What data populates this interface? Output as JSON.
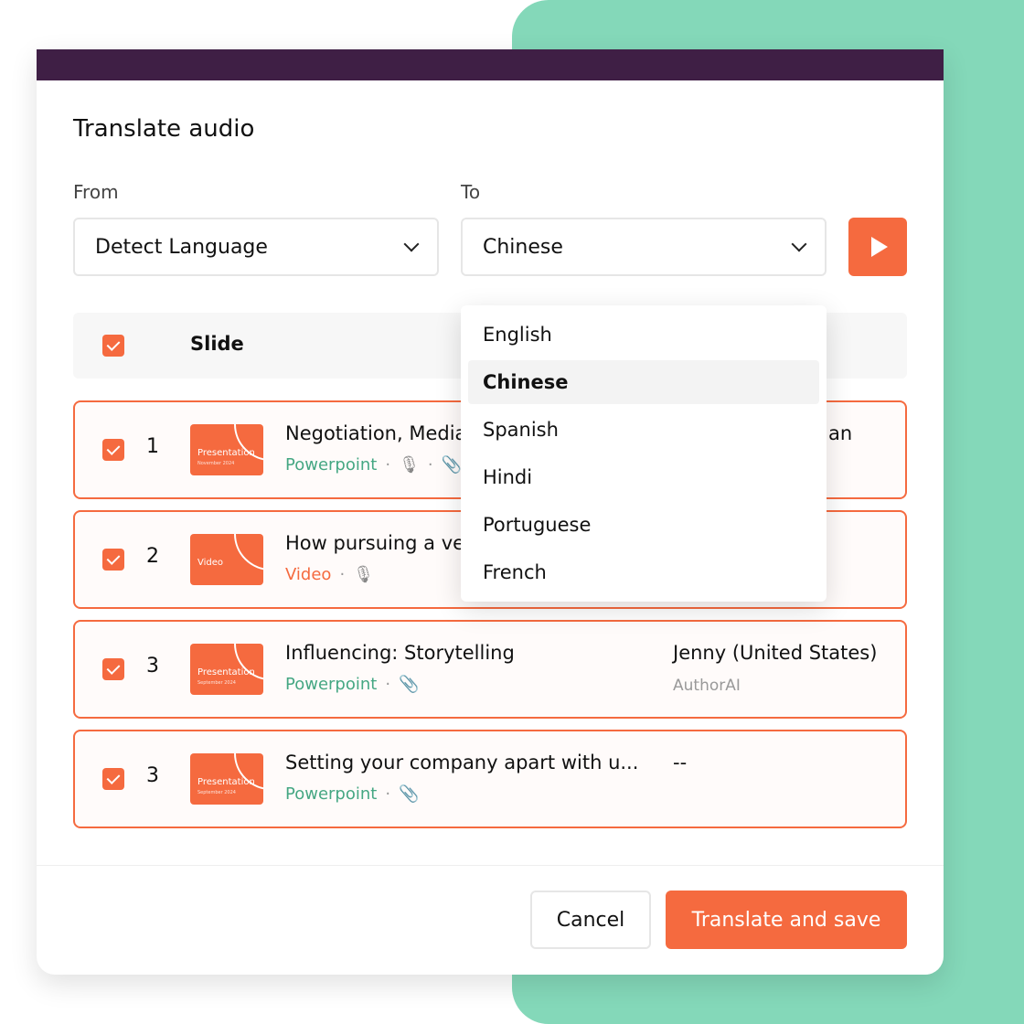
{
  "dialog": {
    "title": "Translate audio",
    "from_label": "From",
    "to_label": "To",
    "from_value": "Detect Language",
    "to_value": "Chinese"
  },
  "table": {
    "header": "Slide"
  },
  "rows": [
    {
      "num": "1",
      "thumb_title": "Presentation",
      "thumb_sub": "November 2024",
      "title": "Negotiation, Media",
      "type": "Powerpoint",
      "icons": [
        "microphone-icon",
        "paperclip-icon"
      ],
      "voice": "an",
      "source": ""
    },
    {
      "num": "2",
      "thumb_title": "Video",
      "thumb_sub": "",
      "title": "How pursuing a ve",
      "type": "Video",
      "icons": [
        "microphone-icon"
      ],
      "voice": "",
      "source": ""
    },
    {
      "num": "3",
      "thumb_title": "Presentation",
      "thumb_sub": "September 2024",
      "title": "Influencing: Storytelling",
      "type": "Powerpoint",
      "icons": [
        "paperclip-icon"
      ],
      "voice": "Jenny (United States)",
      "source": "AuthorAI"
    },
    {
      "num": "3",
      "thumb_title": "Presentation",
      "thumb_sub": "September 2024",
      "title": "Setting your company apart with u...",
      "type": "Powerpoint",
      "icons": [
        "paperclip-icon"
      ],
      "voice": "--",
      "source": ""
    }
  ],
  "dropdown": {
    "options": [
      "English",
      "Chinese",
      "Spanish",
      "Hindi",
      "Portuguese",
      "French"
    ],
    "selected": "Chinese"
  },
  "footer": {
    "cancel": "Cancel",
    "save": "Translate and save"
  },
  "colors": {
    "accent": "#f56a3f",
    "powerpoint": "#45a783",
    "topbar": "#3f1f45",
    "background": "#84d8b9"
  }
}
